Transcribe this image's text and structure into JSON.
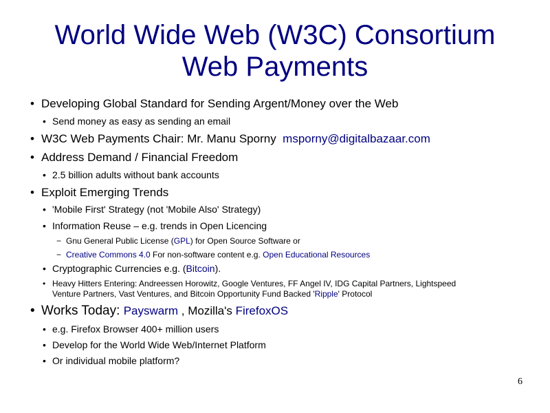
{
  "slide": {
    "title_line1": "World Wide Web (W3C) Consortium",
    "title_line2": "Web Payments",
    "page_number": "6"
  },
  "items": {
    "i1": "Developing Global Standard for Sending Argent/Money over the Web",
    "i1a": "Send money as easy as sending an email",
    "i2_text": "W3C Web Payments Chair: Mr. Manu Sporny",
    "i2_email": "msporny@digitalbazaar.com",
    "i3": "Address Demand / Financial Freedom",
    "i3a": "2.5 billion adults without bank accounts",
    "i4": "Exploit Emerging Trends",
    "i4a": "'Mobile First' Strategy (not 'Mobile Also' Strategy)",
    "i4b": "Information Reuse – e.g. trends in Open Licencing",
    "i4b1_pre": "Gnu General Public License (",
    "i4b1_link": "GPL",
    "i4b1_post": ") for Open Source Software or",
    "i4b2_link": "Creative Commons 4.0",
    "i4b2_mid": " For non-software content e.g. ",
    "i4b2_link2": "Open Educational Resources",
    "i4c_pre": "Cryptographic Currencies e.g. (",
    "i4c_link": "Bitcoin",
    "i4c_post": ").",
    "i4d_line1": "Heavy Hitters Entering: Andreessen Horowitz, Google Ventures, FF Angel IV, IDG Capital Partners, Lightspeed",
    "i4d_line2_pre": "Venture Partners, Vast Ventures, and Bitcoin Opportunity Fund  Backed '",
    "i4d_line2_link": "Ripple",
    "i4d_line2_post": "' Protocol",
    "i5_pre": "Works Today: ",
    "i5_link1": "Payswarm",
    "i5_mid": " , Mozilla's ",
    "i5_link2": "FirefoxOS",
    "i5a": "e.g. Firefox Browser 400+ million users",
    "i5b": "Develop for the World Wide Web/Internet  Platform",
    "i5c": "Or individual mobile platform?"
  },
  "colors": {
    "title": "#000080",
    "link": "#000080",
    "text": "#000000"
  }
}
